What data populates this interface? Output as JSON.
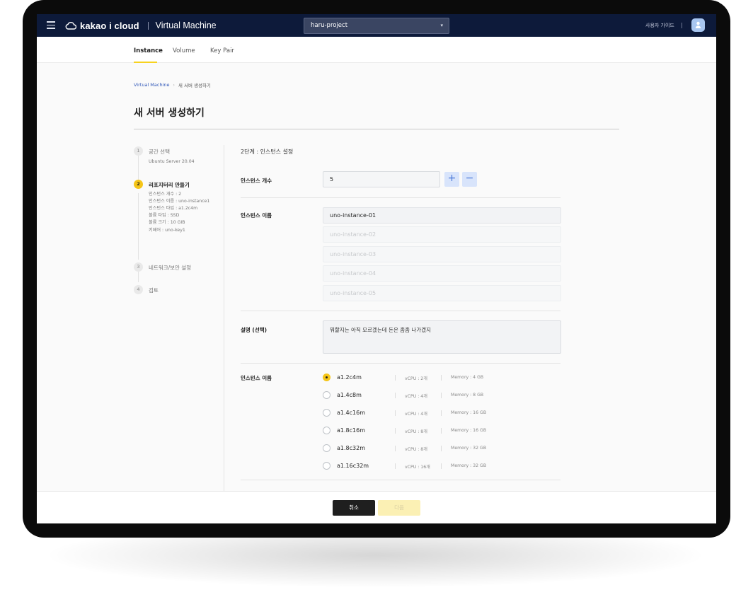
{
  "topbar": {
    "brand": "kakao i cloud",
    "service": "Virtual Machine",
    "project": "haru-project",
    "guide": "사용자 가이드"
  },
  "tabs": [
    {
      "label": "Instance",
      "active": true
    },
    {
      "label": "Volume",
      "active": false
    },
    {
      "label": "Key Pair",
      "active": false
    }
  ],
  "breadcrumb": {
    "root": "Virtual Machine",
    "current": "새 서버 생성하기"
  },
  "page_title": "새 서버 생성하기",
  "steps": [
    {
      "num": "1",
      "label": "공간 선택",
      "details": [
        "Ubuntu Server 20.04"
      ],
      "state": "done"
    },
    {
      "num": "2",
      "label": "리포지터리 만들기",
      "details": [
        "인스턴스 개수 : 2",
        "인스턴스 이름 : uno-instance1",
        "인스턴스 타입 : a1.2c4m",
        "볼륨 타입 : SSD",
        "볼륨 크기 : 10 GIB",
        "키페어 : uno-key1"
      ],
      "state": "active"
    },
    {
      "num": "3",
      "label": "네트워크/보안 설정",
      "details": [],
      "state": "todo"
    },
    {
      "num": "4",
      "label": "검토",
      "details": [],
      "state": "todo"
    }
  ],
  "form": {
    "stage_title": "2단계 : 인스턴스 설정",
    "count_label": "인스턴스 개수",
    "count_value": "5",
    "plus": "+",
    "minus": "−",
    "names_label": "인스턴스 이름",
    "names": [
      "uno-instance-01",
      "uno-instance-02",
      "uno-instance-03",
      "uno-instance-04",
      "uno-instance-05"
    ],
    "desc_label": "설명 (선택)",
    "desc_value": "뭐할지는 아직 모르겠는데 돈은 좀좀 나가겠지",
    "type_label": "인스턴스 이름",
    "types": [
      {
        "name": "a1.2c4m",
        "vcpu": "vCPU : 2개",
        "memory": "Memory : 4 GB",
        "selected": true
      },
      {
        "name": "a1.4c8m",
        "vcpu": "vCPU : 4개",
        "memory": "Memory : 8 GB",
        "selected": false
      },
      {
        "name": "a1.4c16m",
        "vcpu": "vCPU : 4개",
        "memory": "Memory : 16 GB",
        "selected": false
      },
      {
        "name": "a1.8c16m",
        "vcpu": "vCPU : 8개",
        "memory": "Memory : 16 GB",
        "selected": false
      },
      {
        "name": "a1.8c32m",
        "vcpu": "vCPU : 8개",
        "memory": "Memory : 32 GB",
        "selected": false
      },
      {
        "name": "a1.16c32m",
        "vcpu": "vCPU : 16개",
        "memory": "Memory : 32 GB",
        "selected": false
      }
    ]
  },
  "footer": {
    "cancel": "취소",
    "next": "다음"
  },
  "colors": {
    "nav_bg": "#0d1a3a",
    "accent": "#f5c518",
    "link": "#2f56b8"
  }
}
